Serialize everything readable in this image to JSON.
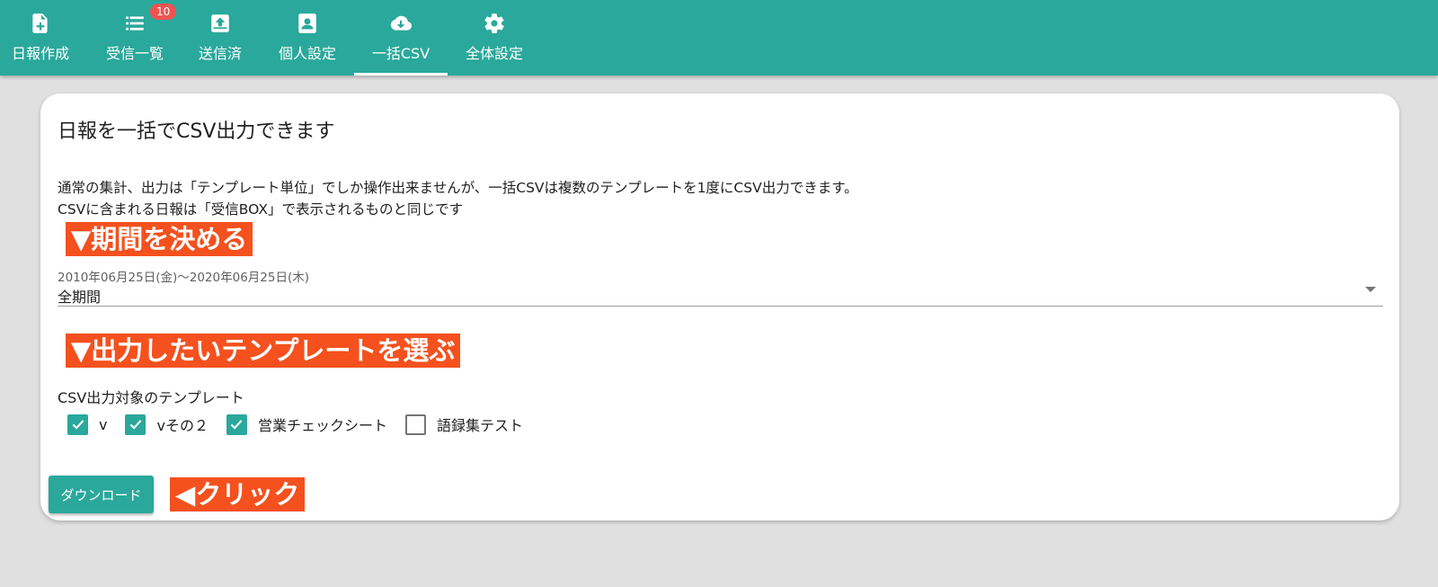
{
  "nav": {
    "tabs": [
      {
        "label": "日報作成",
        "icon": "file-plus-icon"
      },
      {
        "label": "受信一覧",
        "icon": "list-icon",
        "badge": "10"
      },
      {
        "label": "送信済",
        "icon": "outbox-icon"
      },
      {
        "label": "個人設定",
        "icon": "user-card-icon"
      },
      {
        "label": "一括CSV",
        "icon": "cloud-download-icon",
        "active": true
      },
      {
        "label": "全体設定",
        "icon": "gear-icon"
      }
    ]
  },
  "main": {
    "title": "日報を一括でCSV出力できます",
    "description_line1": "通常の集計、出力は「テンプレート単位」でしか操作出来ませんが、一括CSVは複数のテンプレートを1度にCSV出力できます。",
    "description_line2": "CSVに含まれる日報は「受信BOX」で表示されるものと同じです",
    "callout_period": "▼期間を決める",
    "period_range": "2010年06月25日(金)〜2020年06月25日(木)",
    "period_value": "全期間",
    "callout_template": "▼出力したいテンプレートを選ぶ",
    "template_label": "CSV出力対象のテンプレート",
    "templates": [
      {
        "label": "v",
        "checked": true
      },
      {
        "label": "vその２",
        "checked": true
      },
      {
        "label": "営業チェックシート",
        "checked": true
      },
      {
        "label": "語録集テスト",
        "checked": false
      }
    ],
    "download_label": "ダウンロード",
    "callout_click": "◀クリック"
  },
  "colors": {
    "primary": "#2aa89b",
    "callout": "#f4511e",
    "badge": "#ef5350"
  }
}
